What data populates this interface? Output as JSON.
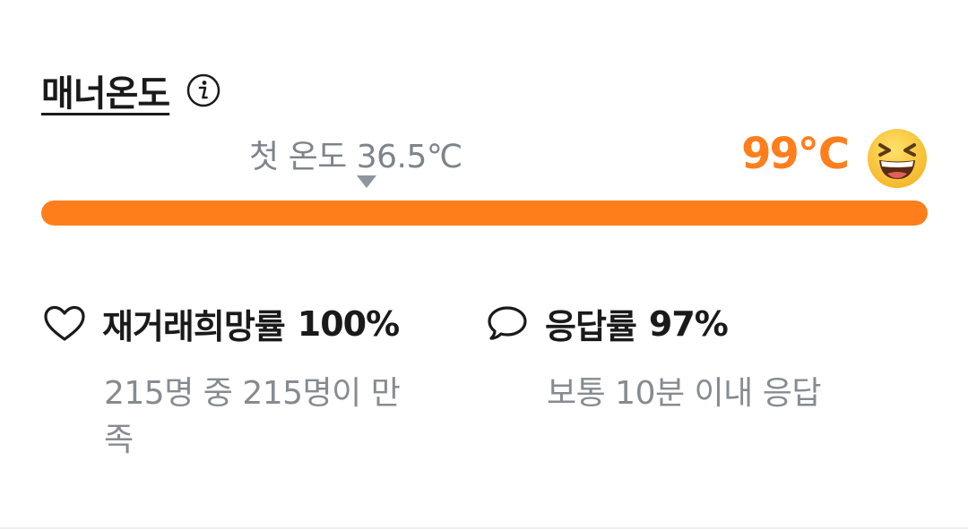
{
  "header": {
    "title": "매너온도",
    "info_icon": "info-icon"
  },
  "temperature": {
    "first_temp_label": "첫 온도 36.5℃",
    "current_value": "99℃",
    "current_numeric": 99,
    "first_numeric": 36.5,
    "max": 99,
    "emoji_icon": "laughing-face-icon",
    "accent_color": "#ff7e1c",
    "track_color": "#e9ecef"
  },
  "stats": {
    "rehire": {
      "icon": "heart-outline-icon",
      "label": "재거래희망률",
      "value": "100%",
      "detail": "215명 중 215명이 만족"
    },
    "response": {
      "icon": "speech-bubble-icon",
      "label": "응답률",
      "value": "97%",
      "detail": "보통 10분 이내 응답"
    }
  }
}
